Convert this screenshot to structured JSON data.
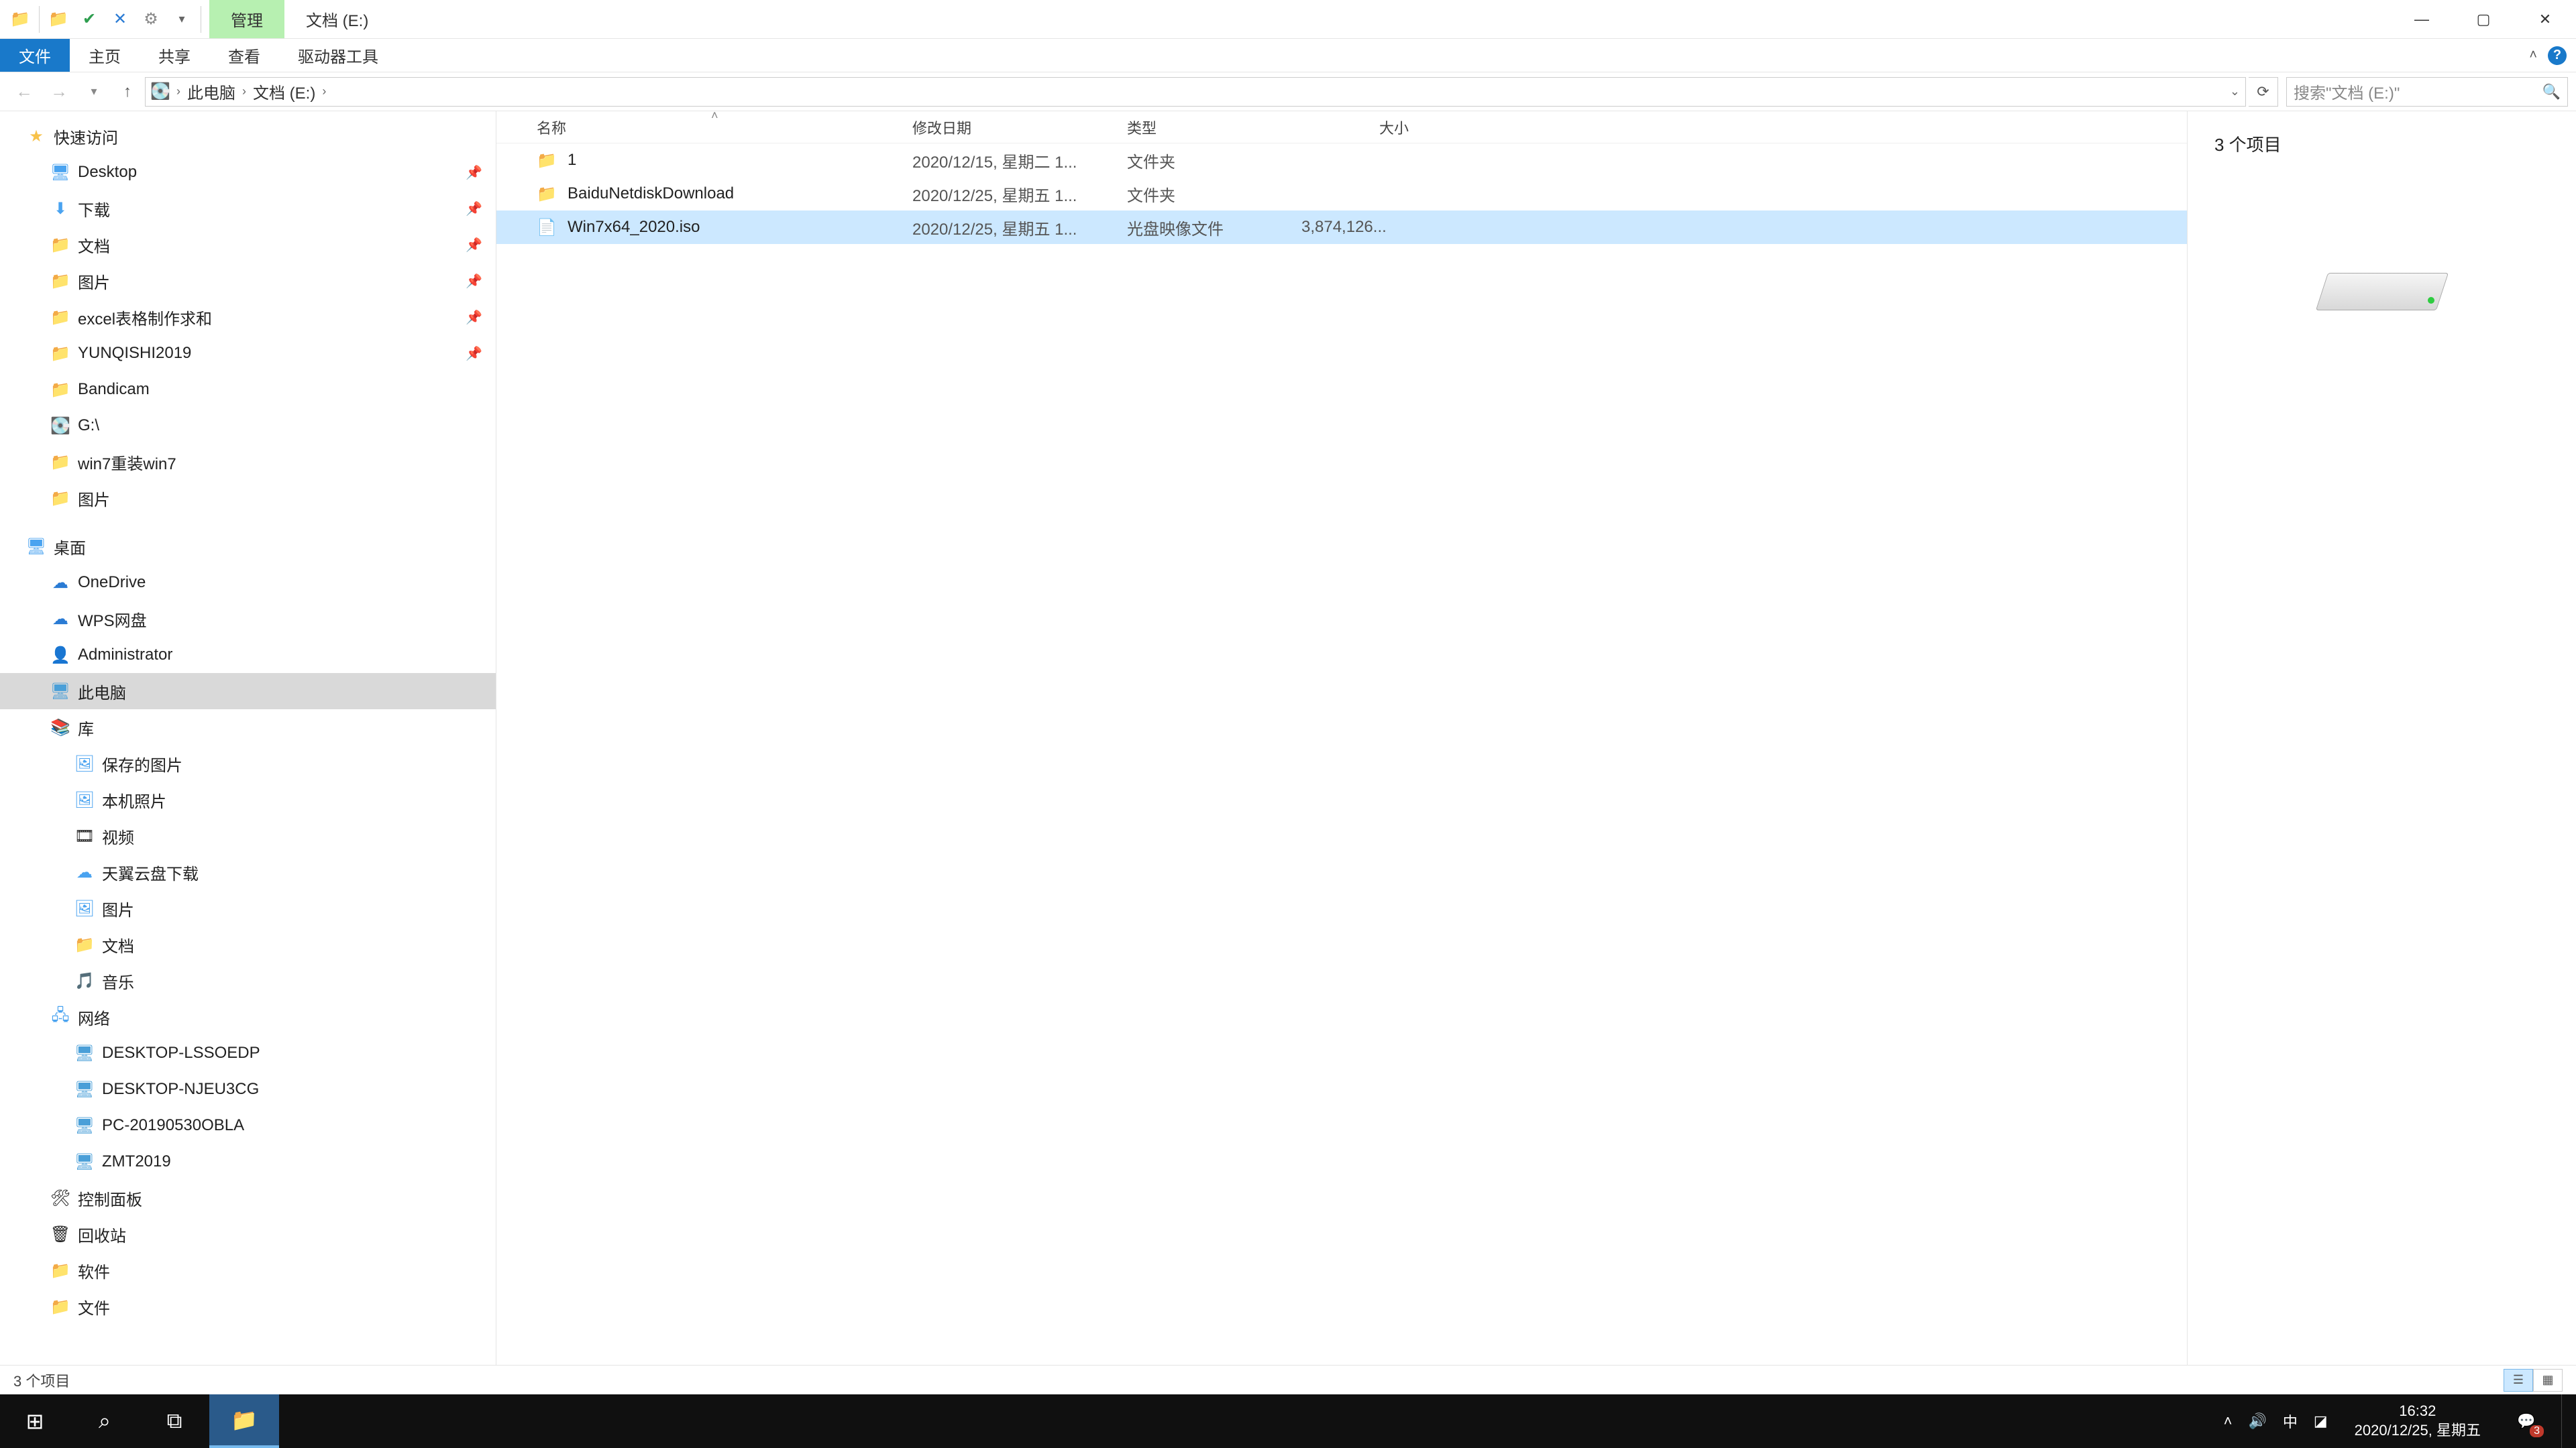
{
  "titlebar": {
    "manage_tab": "管理",
    "location_tab": "文档 (E:)"
  },
  "ribbon": {
    "file": "文件",
    "home": "主页",
    "share": "共享",
    "view": "查看",
    "drive_tools": "驱动器工具"
  },
  "nav": {
    "crumb_pc": "此电脑",
    "crumb_loc": "文档 (E:)",
    "refresh_dropdown": "⌄"
  },
  "search": {
    "placeholder": "搜索\"文档 (E:)\""
  },
  "tree": {
    "quick_access": "快速访问",
    "desktop": "Desktop",
    "downloads": "下载",
    "documents": "文档",
    "pictures": "图片",
    "excel": "excel表格制作求和",
    "yunqishi": "YUNQISHI2019",
    "bandicam": "Bandicam",
    "gdrive": "G:\\",
    "win7": "win7重装win7",
    "pictures2": "图片",
    "desktop2": "桌面",
    "onedrive": "OneDrive",
    "wps": "WPS网盘",
    "admin": "Administrator",
    "this_pc": "此电脑",
    "libraries": "库",
    "saved_pic": "保存的图片",
    "local_pic": "本机照片",
    "videos": "视频",
    "tianyi": "天翼云盘下载",
    "lib_pic": "图片",
    "lib_doc": "文档",
    "lib_music": "音乐",
    "network": "网络",
    "pc1": "DESKTOP-LSSOEDP",
    "pc2": "DESKTOP-NJEU3CG",
    "pc3": "PC-20190530OBLA",
    "pc4": "ZMT2019",
    "control_panel": "控制面板",
    "recycle": "回收站",
    "software": "软件",
    "files": "文件"
  },
  "columns": {
    "name": "名称",
    "date": "修改日期",
    "type": "类型",
    "size": "大小"
  },
  "files": [
    {
      "name": "1",
      "date": "2020/12/15, 星期二 1...",
      "type": "文件夹",
      "size": "",
      "icon": "folder",
      "selected": false
    },
    {
      "name": "BaiduNetdiskDownload",
      "date": "2020/12/25, 星期五 1...",
      "type": "文件夹",
      "size": "",
      "icon": "folder",
      "selected": false
    },
    {
      "name": "Win7x64_2020.iso",
      "date": "2020/12/25, 星期五 1...",
      "type": "光盘映像文件",
      "size": "3,874,126...",
      "icon": "file",
      "selected": true
    }
  ],
  "preview": {
    "count_label": "3 个项目"
  },
  "status": {
    "text": "3 个项目"
  },
  "taskbar": {
    "ime": "中",
    "time": "16:32",
    "date": "2020/12/25, 星期五",
    "notif_count": "3"
  }
}
